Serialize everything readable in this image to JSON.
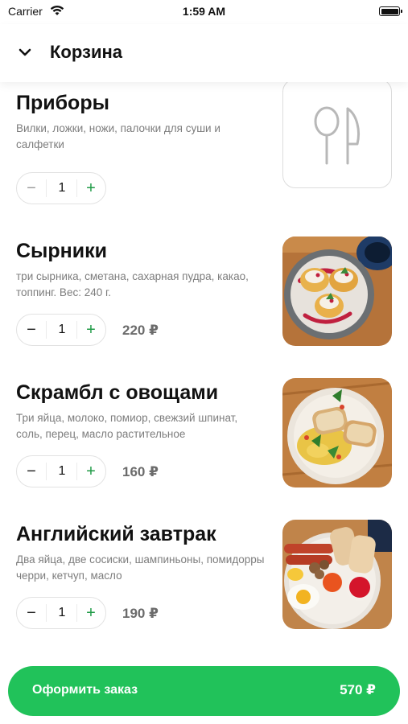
{
  "status_bar": {
    "carrier": "Carrier",
    "time": "1:59 AM"
  },
  "header": {
    "title": "Корзина",
    "back_icon": "chevron-down-icon"
  },
  "cart": {
    "items": [
      {
        "title": "Приборы",
        "description": "Вилки, ложки, ножи, палочки для суши и салфетки",
        "quantity": "1",
        "price": "",
        "image": "cutlery-icon"
      },
      {
        "title": "Сырники",
        "description": "три сырника, сметана, сахарная пудра, какао, топпинг. Вес: 240 г.",
        "quantity": "1",
        "price": "220 ₽",
        "image": "syrniki-photo"
      },
      {
        "title": "Скрамбл с овощами",
        "description": "Три яйца, молоко, помиор, свежзий шпинат, соль, перец, масло растительное",
        "quantity": "1",
        "price": "160 ₽",
        "image": "scramble-photo"
      },
      {
        "title": "Английский завтрак",
        "description": "Два яйца, две сосиски, шампиньоны, помидорры черри, кетчуп, масло",
        "quantity": "1",
        "price": "190 ₽",
        "image": "english-breakfast-photo"
      }
    ]
  },
  "checkout": {
    "label": "Оформить заказ",
    "total": "570 ₽"
  },
  "colors": {
    "accent": "#21c25a",
    "plus": "#1f9a46",
    "muted_text": "#7d7d7d"
  }
}
